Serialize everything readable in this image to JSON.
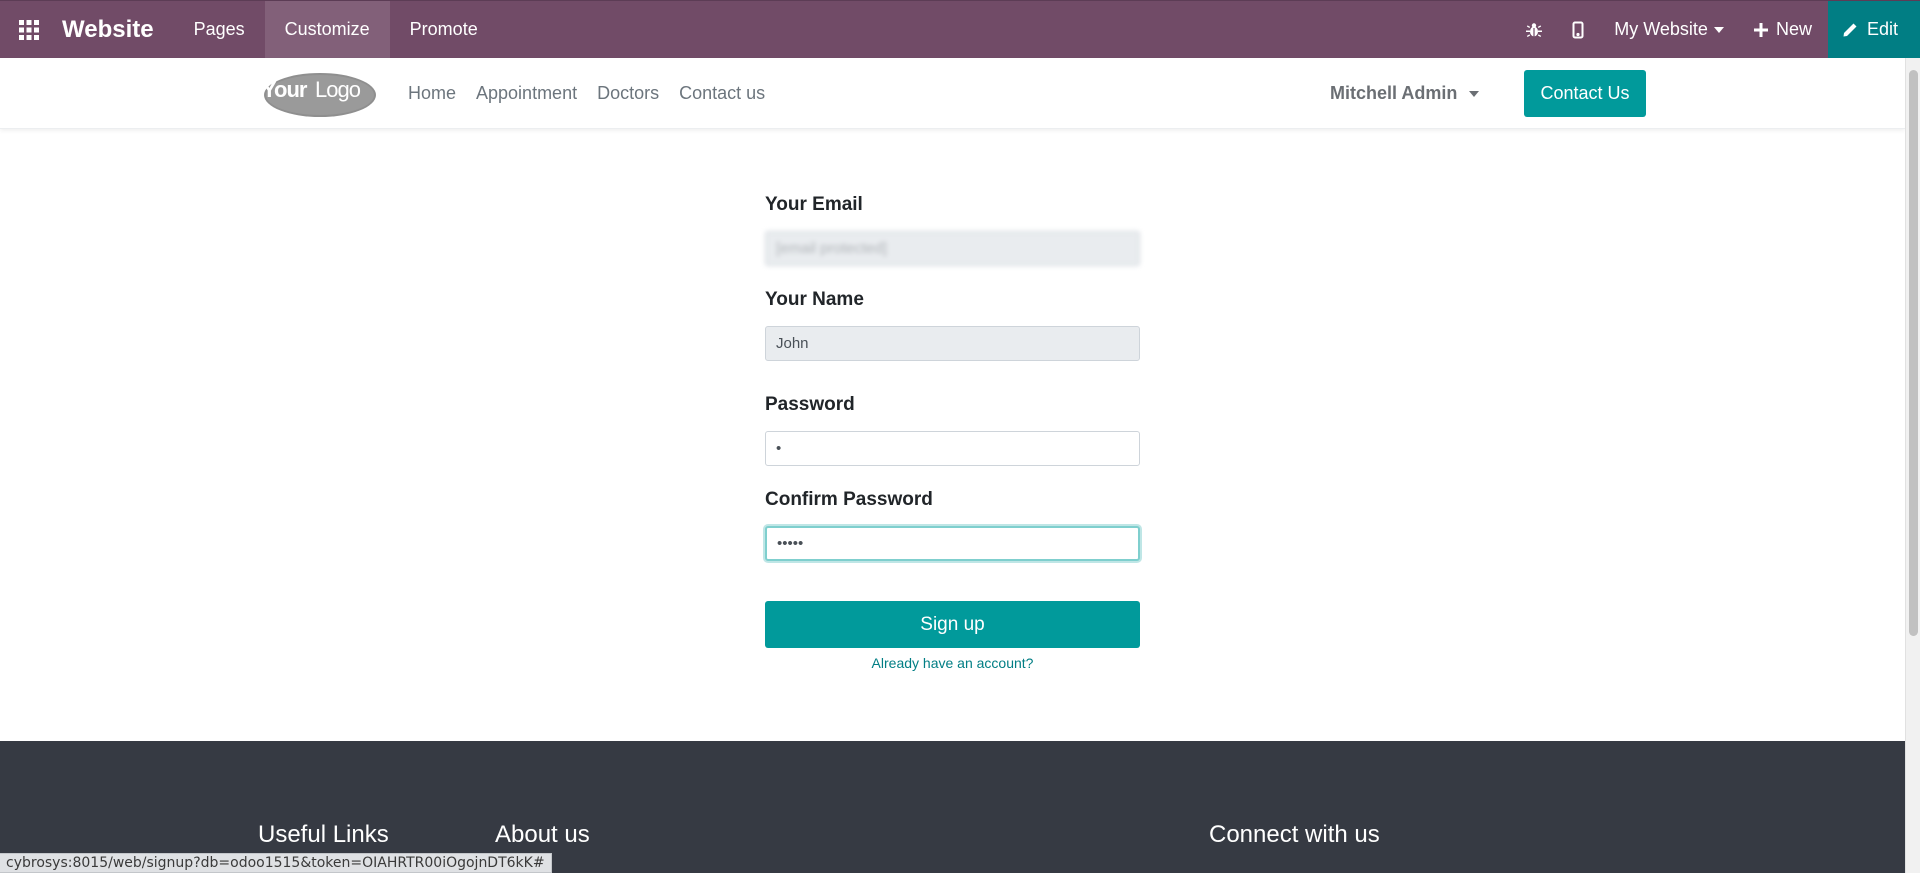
{
  "topbar": {
    "apps_icon": "grid-icon",
    "brand": "Website",
    "menu": [
      "Pages",
      "Customize",
      "Promote"
    ],
    "active_menu": "Customize",
    "debug_icon": "bug-icon",
    "mobile_icon": "mobile-icon",
    "website_select": "My Website",
    "new_label": "New",
    "edit_label": "Edit",
    "bg_color": "#714b67",
    "edit_color": "#017e84"
  },
  "site_header": {
    "logo_text": "YourLogo",
    "logo_your": "Your",
    "logo_logo": "Logo",
    "nav": [
      "Home",
      "Appointment",
      "Doctors",
      "Contact us"
    ],
    "user": "Mitchell Admin",
    "contact_button": "Contact Us",
    "accent_color": "#019a9b"
  },
  "form": {
    "email_label": "Your Email",
    "email_value": "[email protected]",
    "name_label": "Your Name",
    "name_value": "John",
    "password_label": "Password",
    "password_value": "•",
    "confirm_label": "Confirm Password",
    "confirm_value": "•••••",
    "signup_button": "Sign up",
    "have_account_link": "Already have an account?"
  },
  "footer": {
    "headings": [
      "Useful Links",
      "About us",
      "Connect with us"
    ],
    "bg_color": "#363a43"
  },
  "status_bar": {
    "url": "cybrosys:8015/web/signup?db=odoo1515&token=OIAHRTR00iOgojnDT6kK#"
  }
}
